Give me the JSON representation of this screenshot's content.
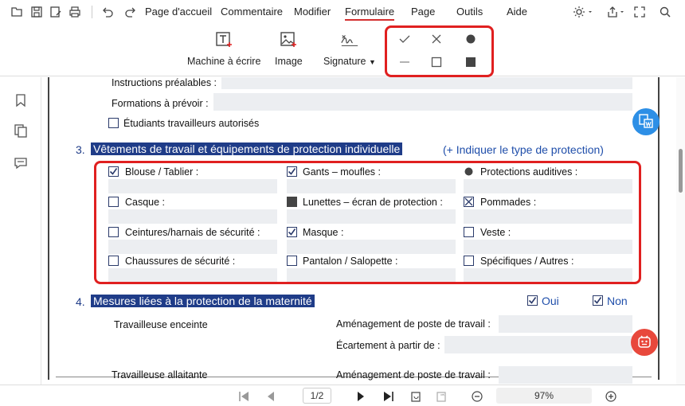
{
  "toolbar": {
    "menu": [
      "Page d'accueil",
      "Commentaire",
      "Modifier",
      "Formulaire",
      "Page",
      "Outils",
      "Aide"
    ],
    "active_menu": "Formulaire"
  },
  "ribbon": {
    "typewriter": "Machine à écrire",
    "image": "Image",
    "signature": "Signature"
  },
  "form": {
    "row1_label": "Instructions préalables :",
    "row2_label": "Formations à prévoir :",
    "students_label": "Étudiants travailleurs autorisés",
    "section3": {
      "num": "3.",
      "title": "Vêtements de travail et équipements de protection individuelle",
      "hint": "(+ Indiquer le type de protection)",
      "items": [
        {
          "label": "Blouse / Tablier :",
          "mark": "check"
        },
        {
          "label": "Gants – moufles :",
          "mark": "check"
        },
        {
          "label": "Protections auditives :",
          "mark": "dot"
        },
        {
          "label": "Casque :",
          "mark": "none"
        },
        {
          "label": "Lunettes – écran de protection :",
          "mark": "square"
        },
        {
          "label": "Pommades :",
          "mark": "cross"
        },
        {
          "label": "Ceintures/harnais de sécurité :",
          "mark": "none"
        },
        {
          "label": "Masque :",
          "mark": "check"
        },
        {
          "label": "Veste :",
          "mark": "none"
        },
        {
          "label": "Chaussures de sécurité :",
          "mark": "none"
        },
        {
          "label": "Pantalon / Salopette :",
          "mark": "none"
        },
        {
          "label": "Spécifiques / Autres :",
          "mark": "none"
        }
      ]
    },
    "section4": {
      "num": "4.",
      "title": "Mesures liées à la protection de la maternité",
      "oui": "Oui",
      "non": "Non",
      "travailleuse_enceinte": "Travailleuse enceinte",
      "amenagement1": "Aménagement de poste de travail :",
      "ecartement": "Écartement à partir de :",
      "travailleuse_allaitante": "Travailleuse allaitante",
      "amenagement2": "Aménagement de poste de travail :"
    }
  },
  "bottombar": {
    "page": "1/2",
    "zoom": "97%"
  }
}
